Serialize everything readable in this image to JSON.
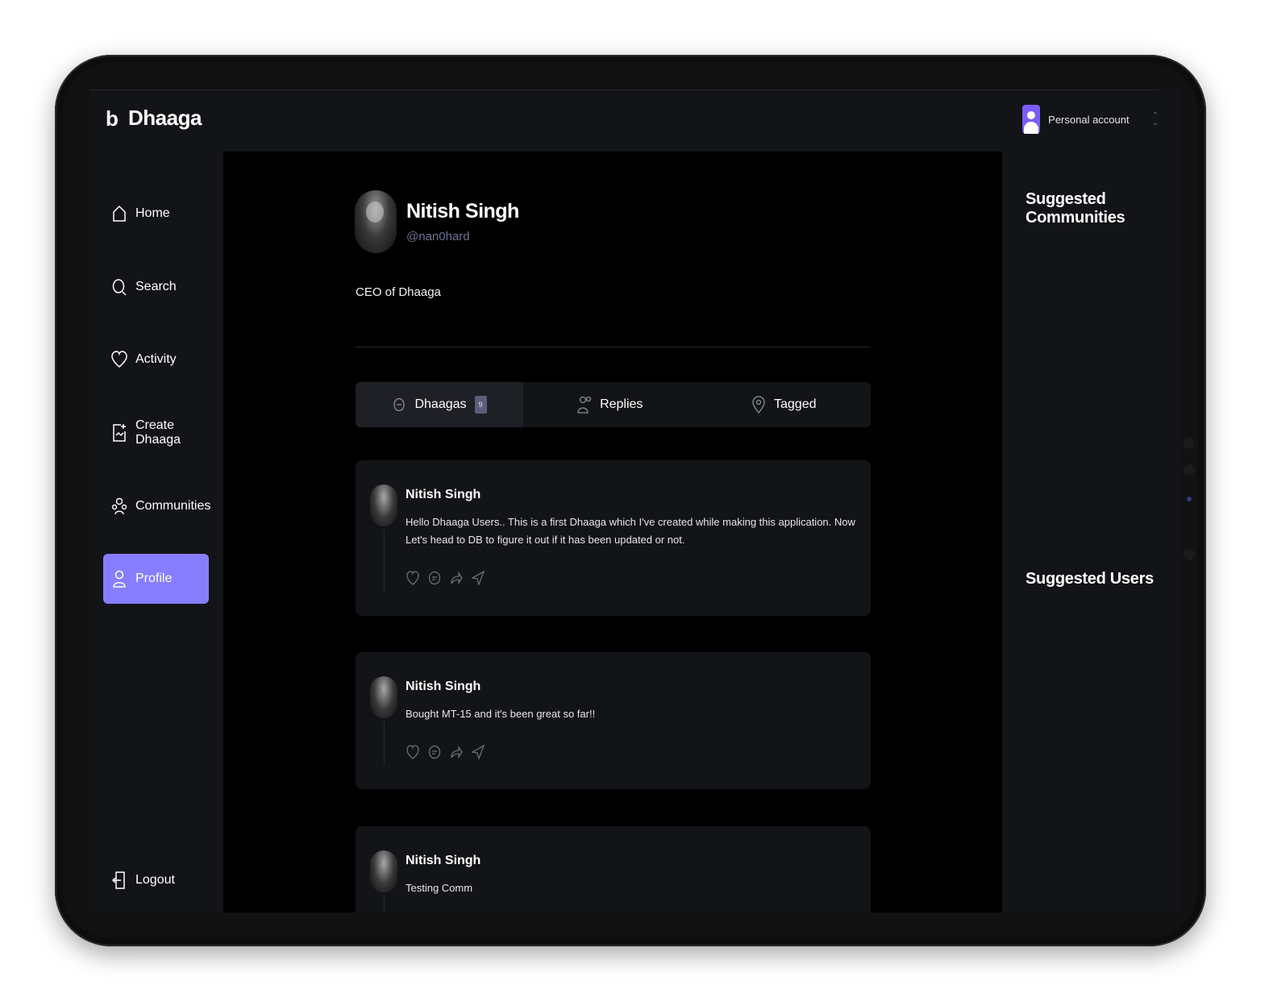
{
  "app": {
    "name": "Dhaaga",
    "logo_glyph": "b"
  },
  "account": {
    "label": "Personal account",
    "accent": "#7c5cf9"
  },
  "sidebar": {
    "items": [
      {
        "label": "Home",
        "icon": "home-icon"
      },
      {
        "label": "Search",
        "icon": "search-icon"
      },
      {
        "label": "Activity",
        "icon": "heart-icon"
      },
      {
        "label": "Create Dhaaga",
        "icon": "create-icon"
      },
      {
        "label": "Communities",
        "icon": "communities-icon"
      },
      {
        "label": "Profile",
        "icon": "profile-icon",
        "active": true
      }
    ],
    "logout": {
      "label": "Logout",
      "icon": "logout-icon"
    },
    "active_color": "#877eff"
  },
  "profile": {
    "name": "Nitish Singh",
    "handle": "@nan0hard",
    "bio": "CEO of Dhaaga"
  },
  "tabs": [
    {
      "label": "Dhaagas",
      "count": "9",
      "icon": "thread-icon",
      "active": true
    },
    {
      "label": "Replies",
      "icon": "replies-icon"
    },
    {
      "label": "Tagged",
      "icon": "tag-icon"
    }
  ],
  "posts": [
    {
      "author": "Nitish Singh",
      "text": "Hello Dhaaga Users.. This is a first Dhaaga which I've created while making this application. Now Let's head to DB to figure it out if it has been updated or not."
    },
    {
      "author": "Nitish Singh",
      "text": "Bought MT-15 and it's been great so far!!"
    },
    {
      "author": "Nitish Singh",
      "text": "Testing Comm"
    }
  ],
  "rightbar": {
    "communities_title": "Suggested Communities",
    "users_title": "Suggested Users"
  }
}
